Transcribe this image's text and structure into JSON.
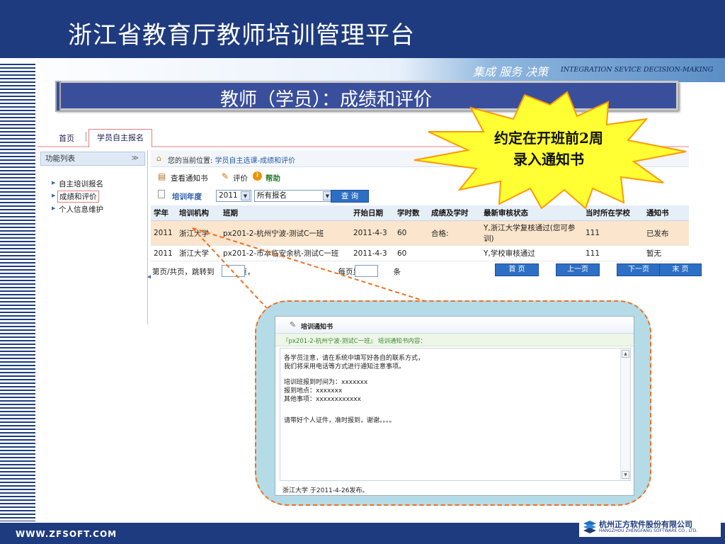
{
  "slide": {
    "title": "浙江省教育厅教师培训管理平台",
    "slogan_cn": "集成 服务 决策",
    "slogan_en": "INTEGRATION SEVICE DECISION-MAKING",
    "heading": "教师（学员）：成绩和评价",
    "footer_site": "WWW.ZFSOFT.COM",
    "footer_company_cn": "杭州正方软件股份有限公司",
    "footer_company_en": "HANGZHOU ZHENGFANG SOFTWARE CO., LTD."
  },
  "callout": {
    "line1": "约定在开班前2周",
    "line2": "录入通知书"
  },
  "app": {
    "nav": {
      "home": "首页",
      "active_tab": "学员自主报名"
    },
    "sidebar": {
      "header": "功能列表",
      "items": [
        {
          "label": "自主培训报名"
        },
        {
          "label": "成绩和评价"
        },
        {
          "label": "个人信息维护"
        }
      ]
    },
    "breadcrumb": {
      "prefix": "您的当前位置: ",
      "path": "学员自主选课-成绩和评价"
    },
    "toolbar": {
      "view_notice": "查看通知书",
      "evaluate": "评价",
      "help": "帮助"
    },
    "filter": {
      "label": "培训年度",
      "year": "2011",
      "scope": "所有报名",
      "query_button": "查 询"
    },
    "table": {
      "columns": [
        "学年",
        "培训机构",
        "班期",
        "开始日期",
        "学时数",
        "成绩及学时",
        "最新审核状态",
        "当时所在学校",
        "通知书"
      ],
      "rows": [
        [
          "2011",
          "浙江大学",
          "px201-2-杭州宁波-测试C一班",
          "2011-4-3",
          "60",
          "合格:",
          "Y,浙江大学复核通过(您可参训)",
          "111",
          "已发布"
        ],
        [
          "2011",
          "浙江大学",
          "px201-2-市本临安余杭-测试C一班",
          "2011-4-3",
          "60",
          "",
          "Y,学校审核通过",
          "111",
          "暂无"
        ]
      ]
    },
    "pager": {
      "text_prefix": "第页/共页，跳转到",
      "text_page": "页，",
      "text_show": "每页显示",
      "text_items": "条",
      "first": "首 页",
      "prev": "上一页",
      "next": "下一页",
      "last": "末 页"
    }
  },
  "notice": {
    "title": "培训通知书",
    "subtitle": "『px201-2-杭州宁波-测试C一班』 培训通知书内容：",
    "lines": [
      "各学员注意，请在系统中填写好各自的联系方式，",
      "我们将采用电话等方式进行通知注意事项。",
      "",
      "培训班报到时间为：xxxxxxx",
      "报到地点：xxxxxxx",
      "其他事项：xxxxxxxxxxxx",
      "",
      "",
      "请带好个人证件，准时报到，谢谢。。。。"
    ],
    "footer": "浙江大学 于2011-4-26发布。"
  },
  "colors": {
    "brand_blue": "#1f3b7f",
    "heading_blue": "#3a4f9c",
    "star_yellow": "#ffff33",
    "star_border": "#ff9900",
    "callout_dash": "#f07020",
    "selected_row": "#fbe5cc",
    "status_red": "#d00000"
  }
}
